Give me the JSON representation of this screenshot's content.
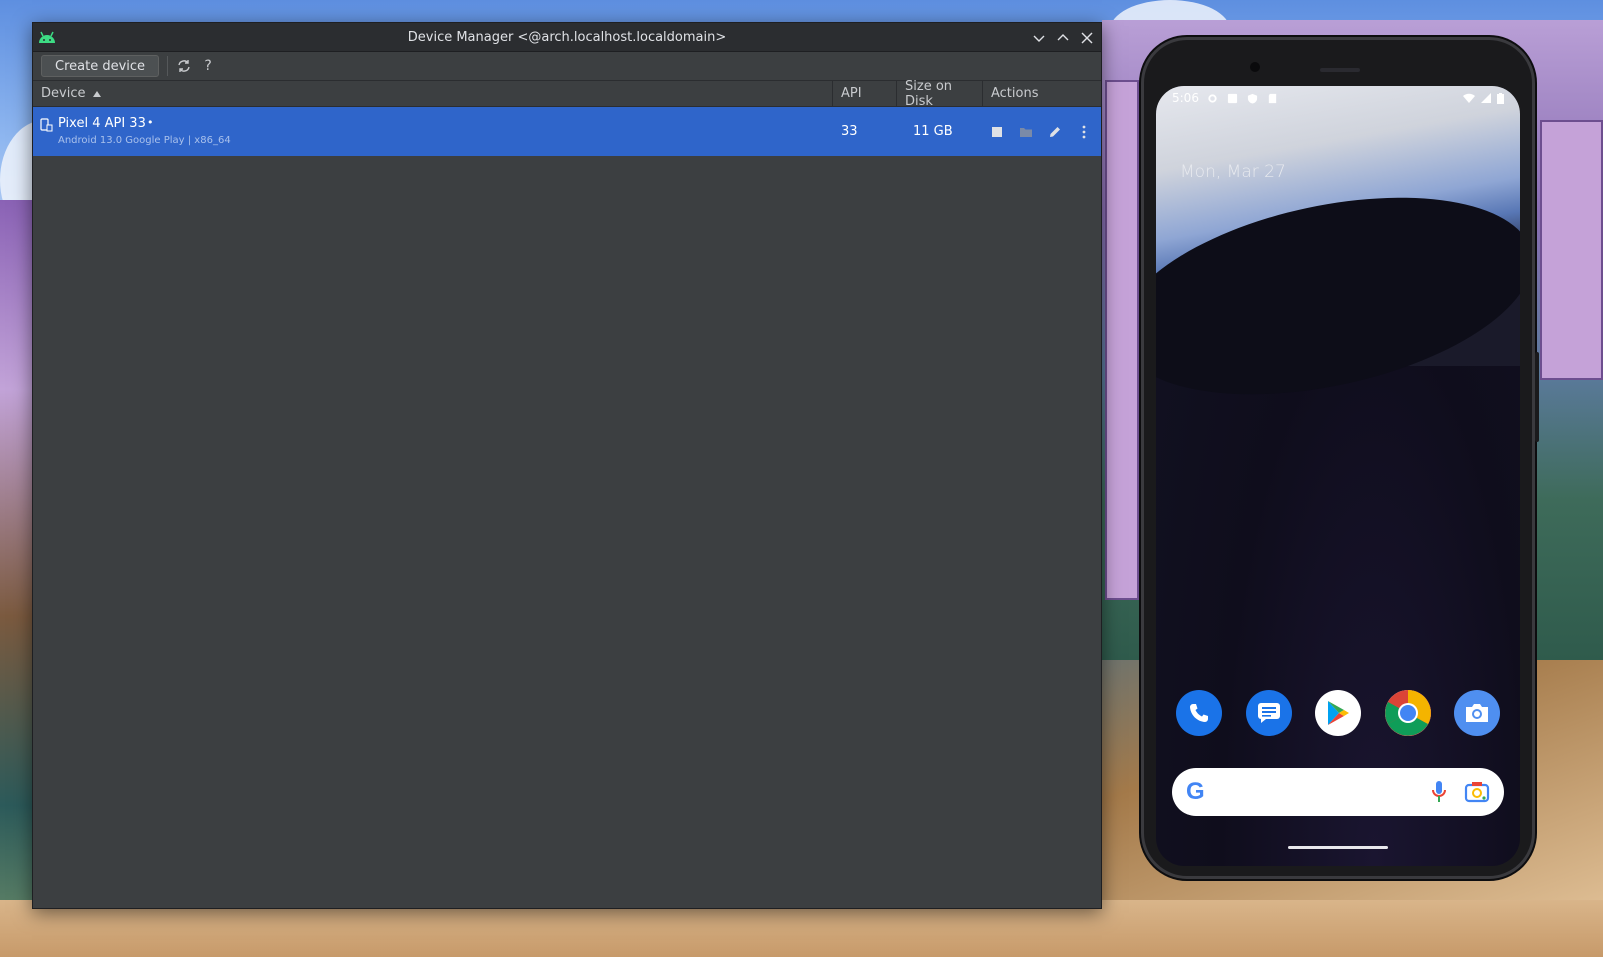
{
  "window": {
    "title": "Device Manager <@arch.localhost.localdomain>"
  },
  "toolbar": {
    "create_label": "Create device",
    "help_label": "?"
  },
  "table": {
    "columns": [
      "Device",
      "API",
      "Size on Disk",
      "Actions"
    ],
    "rows": [
      {
        "name": "Pixel 4 API 33",
        "status_dot": "•",
        "subtitle": "Android 13.0 Google Play | x86_64",
        "api": "33",
        "size": "11 GB"
      }
    ]
  },
  "phone": {
    "time": "5:06",
    "date": "Mon, Mar 27",
    "search_logo": "G",
    "dock_apps": [
      "phone-icon",
      "messages-icon",
      "play-store-icon",
      "chrome-icon",
      "camera-icon"
    ]
  },
  "colors": {
    "selection": "#2f65ca",
    "window_bg": "#3c3f41",
    "titlebar_bg": "#2b2d30",
    "android_green": "#3ddc84"
  }
}
